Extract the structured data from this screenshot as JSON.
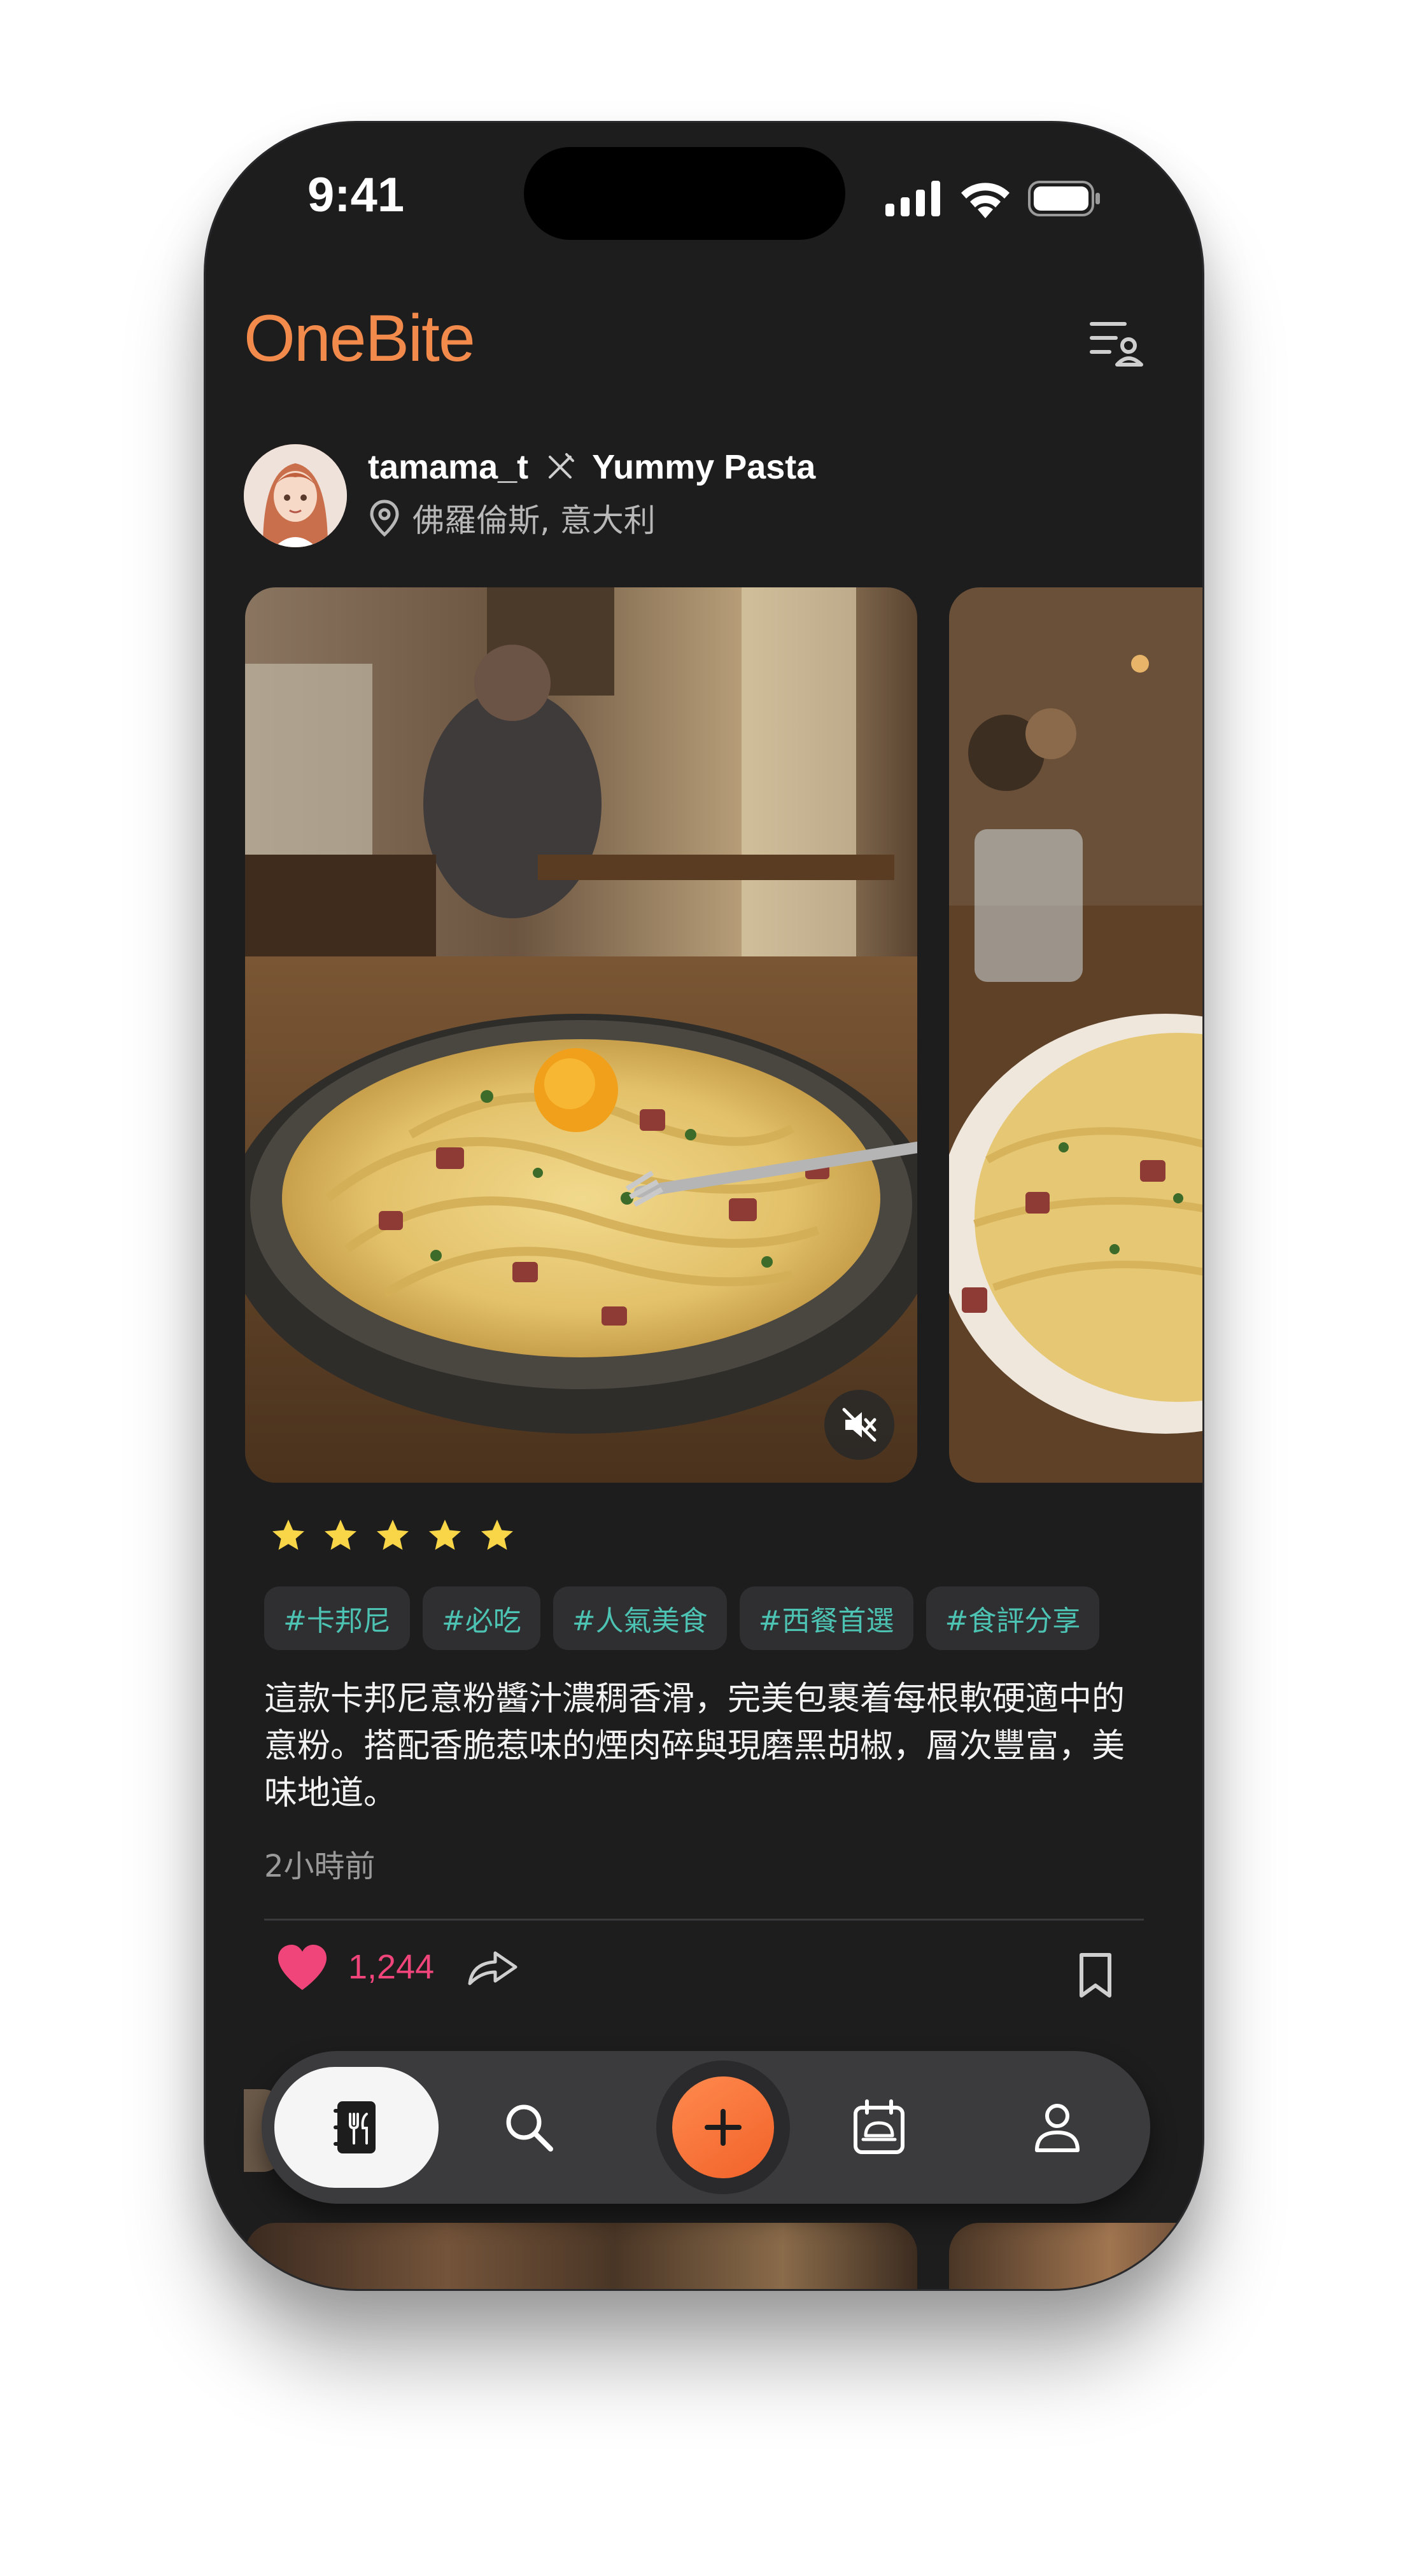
{
  "status_bar": {
    "time": "9:41"
  },
  "header": {
    "logo": "OneBite"
  },
  "post": {
    "username": "tamama_t",
    "dish": "Yummy Pasta",
    "location": "佛羅倫斯, 意大利",
    "rating": 5,
    "tags": [
      "#卡邦尼",
      "#必吃",
      "#人氣美食",
      "#西餐首選",
      "#食評分享"
    ],
    "caption": "這款卡邦尼意粉醬汁濃稠香滑，完美包裹着每根軟硬適中的意粉。搭配香脆惹味的煙肉碎與現磨黑胡椒，層次豐富，美味地道。",
    "time_ago": "2小時前",
    "likes": "1,244"
  },
  "colors": {
    "accent": "#f28a4b",
    "tag_text": "#4dc3b3",
    "like": "#f0457a",
    "background": "#1d1d1e"
  },
  "nav": {
    "items": [
      {
        "icon": "journal-fork-icon",
        "active": true
      },
      {
        "icon": "search-icon"
      },
      {
        "icon": "plus-icon"
      },
      {
        "icon": "calendar-dish-icon"
      },
      {
        "icon": "person-icon"
      }
    ]
  }
}
